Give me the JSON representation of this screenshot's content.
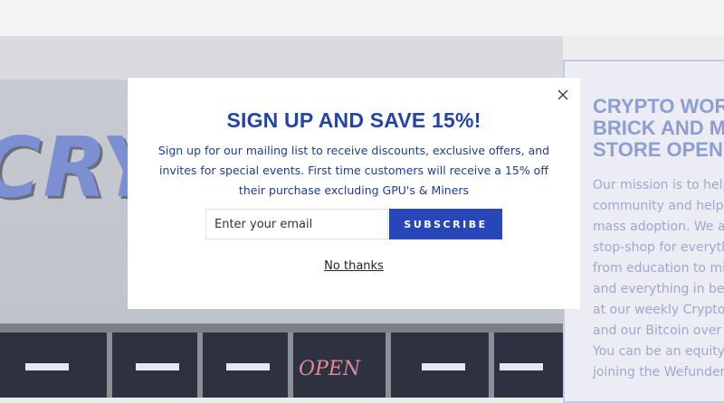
{
  "background": {
    "storefront_sign_text": "CRY",
    "neon_sign_text": "OPEN",
    "side_panel": {
      "heading_lines": [
        "CRYPTO WOR",
        "BRICK AND MO",
        "STORE OPEN N"
      ],
      "body_lines": [
        "Our mission is to help",
        "community and help b",
        "mass adoption. We a",
        "stop-shop for everythin",
        "from education to min",
        "and everything in betw",
        "at our weekly Crypto",
        "and our Bitcoin over B",
        "You can be an equity",
        "joining the Wefunder"
      ]
    }
  },
  "popup": {
    "close_icon": "close-icon",
    "title": "SIGN UP AND SAVE 15%!",
    "description_lines": [
      "Sign up for our mailing list to receive discounts, exclusive offers, and",
      "invites for special events. First time customers will receive a 15% off",
      "their purchase excluding GPU's & Miners"
    ],
    "email_placeholder": "Enter your email",
    "subscribe_label": "SUBSCRIBE",
    "decline_label": "No thanks"
  },
  "colors": {
    "accent": "#2747b8",
    "title": "#2344a8",
    "text": "#1d3c93"
  }
}
